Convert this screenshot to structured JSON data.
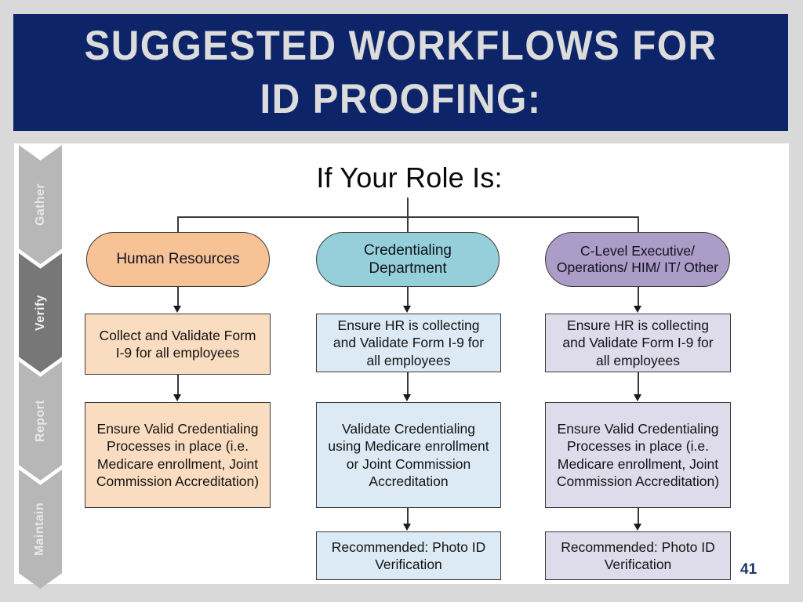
{
  "slide": {
    "title": "Suggested Workflows for ID Proofing:",
    "page_number": "41",
    "background_color": "#d9d9d9",
    "banner_color": "#0d2568",
    "title_color": "#dcdcdc",
    "page_number_color": "#1f3566"
  },
  "rail": {
    "steps": [
      {
        "label": "Gather",
        "active": false,
        "color": "#b7b7b7"
      },
      {
        "label": "Verify",
        "active": true,
        "color": "#777777"
      },
      {
        "label": "Report",
        "active": false,
        "color": "#b7b7b7"
      },
      {
        "label": "Maintain",
        "active": false,
        "color": "#b7b7b7"
      }
    ]
  },
  "diagram": {
    "heading": "If Your Role Is:",
    "columns": [
      {
        "role": "Human Resources",
        "role_color": "#f7c396",
        "box_color": "#fadcc0",
        "steps": [
          "Collect and Validate Form\nI-9 for all employees",
          "Ensure Valid Credentialing\nProcesses in place (i.e.\nMedicare enrollment, Joint\nCommission Accreditation)"
        ]
      },
      {
        "role": "Credentialing\nDepartment",
        "role_color": "#95d0da",
        "box_color": "#dbeaf4",
        "steps": [
          "Ensure HR is collecting\nand Validate Form I-9 for\nall employees",
          "Validate Credentialing\nusing  Medicare enrollment\nor Joint Commission\nAccreditation",
          "Recommended: Photo ID\nVerification"
        ]
      },
      {
        "role": "C-Level Executive/\nOperations/ HIM/ IT/ Other",
        "role_color": "#ab9cc8",
        "box_color": "#dedbeb",
        "steps": [
          "Ensure HR is collecting\nand Validate Form I-9 for\nall employees",
          "Ensure Valid Credentialing\nProcesses in place (i.e.\nMedicare enrollment, Joint\nCommission Accreditation)",
          "Recommended: Photo ID\nVerification"
        ]
      }
    ]
  }
}
